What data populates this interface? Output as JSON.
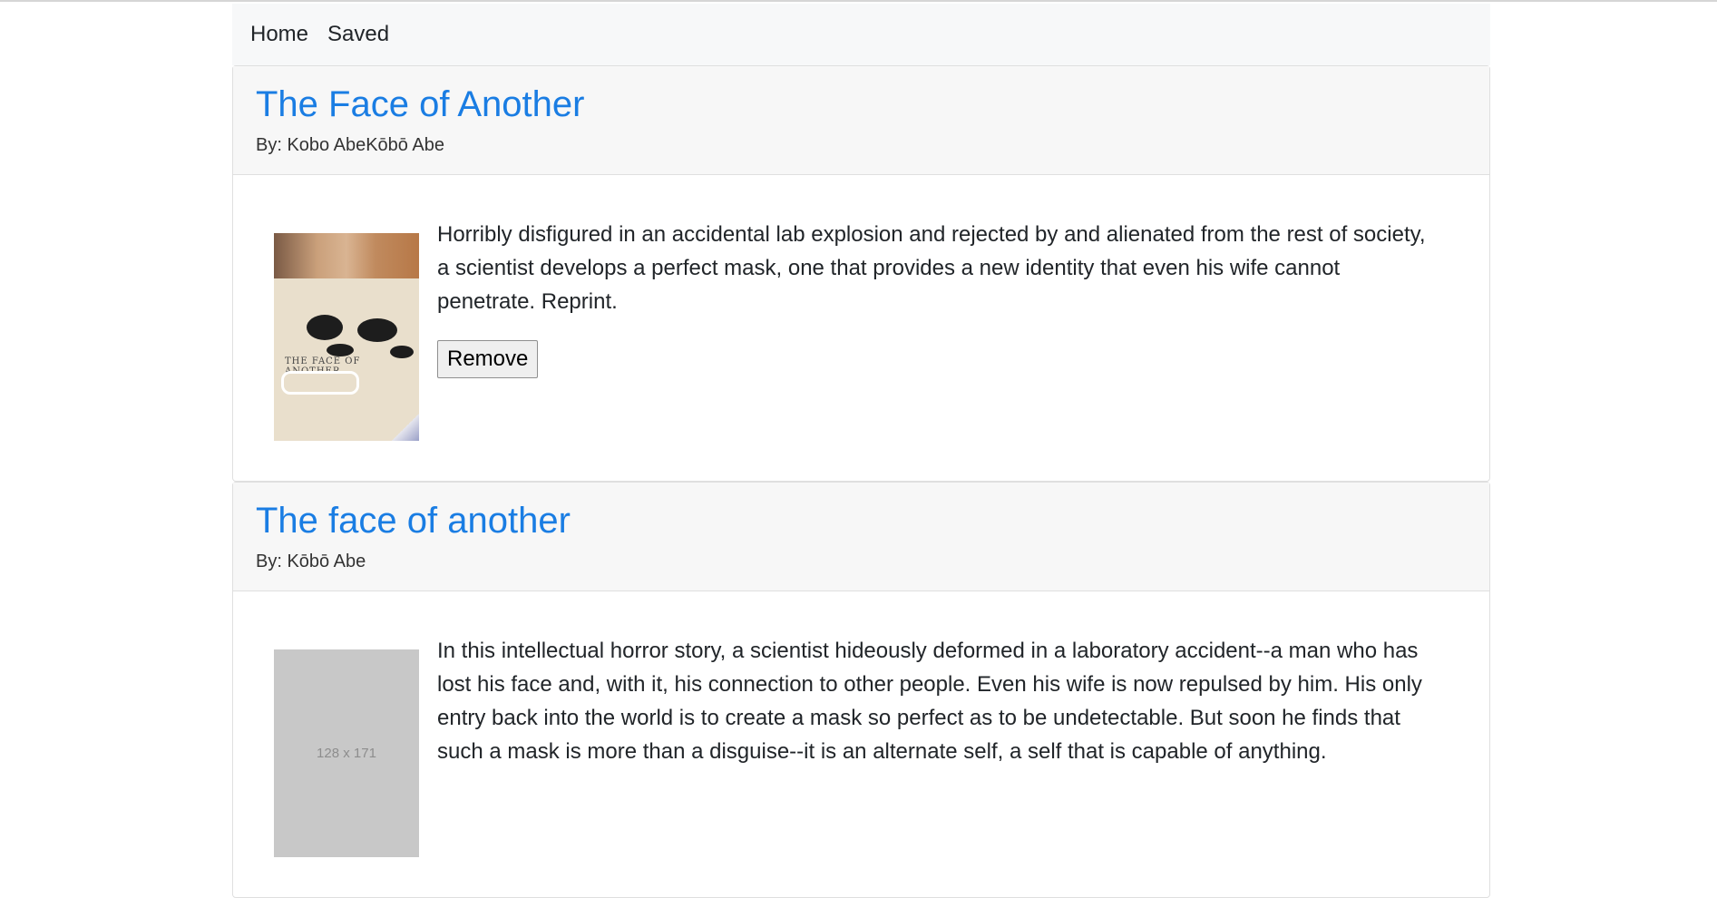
{
  "nav": {
    "home": "Home",
    "saved": "Saved"
  },
  "books": [
    {
      "title": "The Face of Another",
      "author": "By: Kobo AbeKōbō Abe",
      "description": "Horribly disfigured in an accidental lab explosion and rejected by and alienated from the rest of society, a scientist develops a perfect mask, one that provides a new identity that even his wife cannot penetrate. Reprint.",
      "button": "Remove",
      "cover_text": "THE FACE OF ANOTHER"
    },
    {
      "title": "The face of another",
      "author": "By: Kōbō Abe",
      "description": "In this intellectual horror story, a scientist hideously deformed in a laboratory accident--a man who has lost his face and, with it, his connection to other people. Even his wife is now repulsed by him. His only entry back into the world is to create a mask so perfect as to be undetectable. But soon he finds that such a mask is more than a disguise--it is an alternate self, a self that is capable of anything.",
      "cover_placeholder": "128 x 171"
    }
  ],
  "colors": {
    "link": "#1a7de3",
    "nav_bg": "#f7f8f9",
    "header_bg": "#f7f7f7"
  }
}
